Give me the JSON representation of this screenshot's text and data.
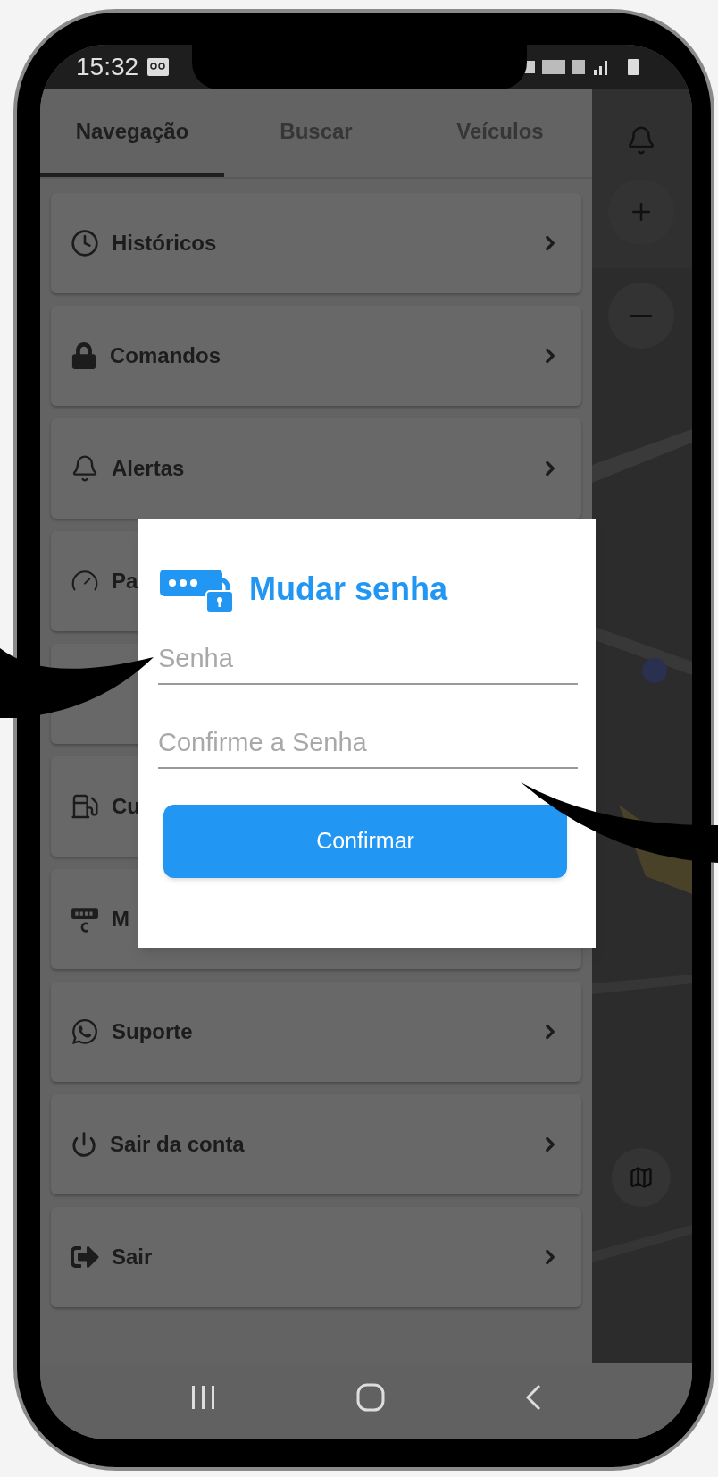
{
  "status_bar": {
    "time": "15:32"
  },
  "tabs": [
    {
      "label": "Navegação",
      "selected": true
    },
    {
      "label": "Buscar",
      "selected": false
    },
    {
      "label": "Veículos",
      "selected": false
    }
  ],
  "menu_items": [
    {
      "kind": "full",
      "label": "Históricos"
    },
    {
      "kind": "full",
      "label": "Comandos"
    },
    {
      "kind": "full",
      "label": "Alertas"
    },
    {
      "kind": "cut",
      "label": "Pa"
    },
    {
      "kind": "covered"
    },
    {
      "kind": "cut",
      "label": "Cu"
    },
    {
      "kind": "cut",
      "label": "M"
    },
    {
      "kind": "full",
      "label": "Suporte"
    },
    {
      "kind": "full",
      "label": "Sair da conta"
    },
    {
      "kind": "full",
      "label": "Sair"
    }
  ],
  "dialog": {
    "title": "Mudar senha",
    "fields": [
      {
        "placeholder": "Senha"
      },
      {
        "placeholder": "Confirme a Senha"
      }
    ],
    "button": "Confirmar"
  }
}
